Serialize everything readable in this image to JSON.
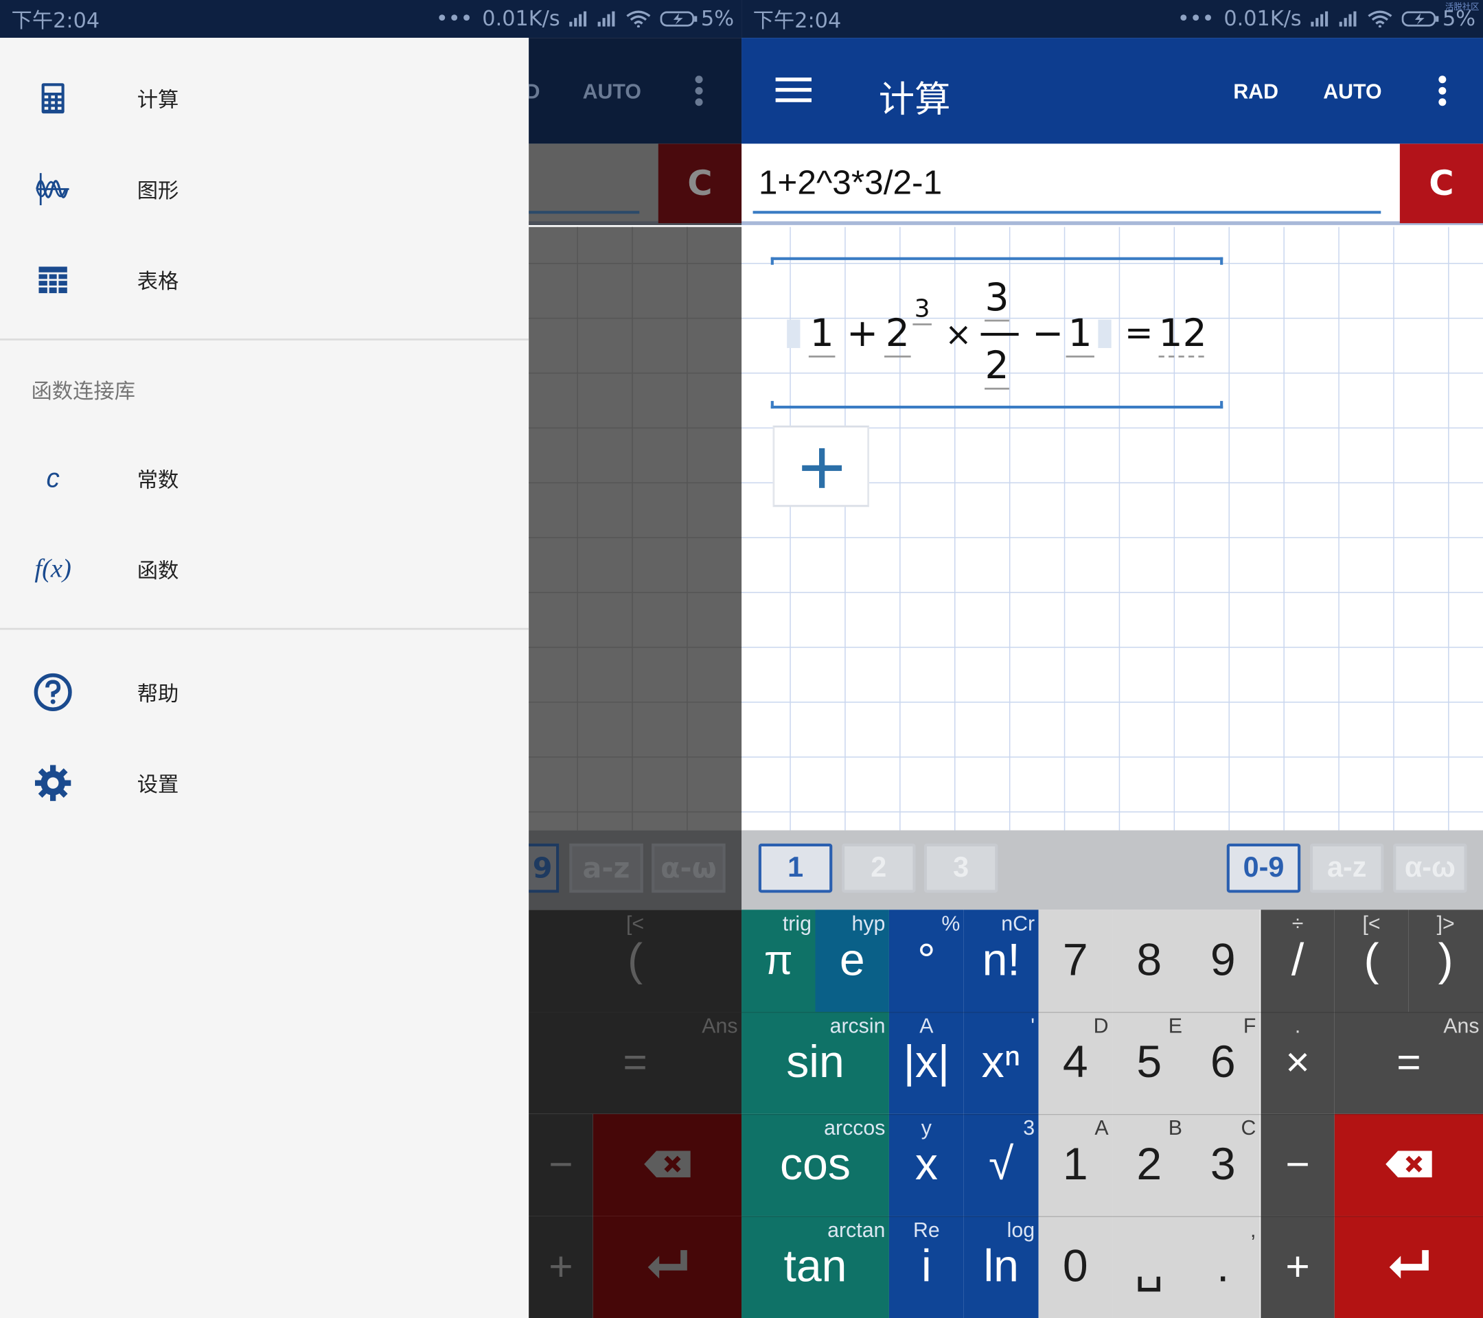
{
  "status": {
    "left_time": "下午2:04",
    "right_time": "下午2:04",
    "speed": "0.01K/s",
    "battery": "5%",
    "dots": "•••",
    "corner_tag": "活脱社区"
  },
  "appbar": {
    "menu_icon": "hamburger-icon",
    "title": "计算",
    "rad_label": "RAD",
    "auto_label": "AUTO",
    "overflow_icon": "more-vert-icon",
    "dim_partial_label": "D"
  },
  "input": {
    "expression": "1+2^3*3/2-1",
    "clear_label": "C"
  },
  "result": {
    "t1": "1",
    "op_plus": "+",
    "base": "2",
    "exp": "3",
    "op_times": "×",
    "num": "3",
    "den": "2",
    "op_minus": "−",
    "t2": "1",
    "eq": "=",
    "value": "12",
    "add_icon": "plus-icon"
  },
  "keyboard": {
    "tabs_left": [
      "1",
      "2",
      "3"
    ],
    "tabs_right": [
      "0-9",
      "a-z",
      "α-ω"
    ],
    "rows": [
      {
        "fn": [
          {
            "main": "π",
            "sup": "trig"
          },
          {
            "main": "e",
            "sup": "hyp"
          },
          {
            "main": "°",
            "sup": "%"
          },
          {
            "main": "n!",
            "sup": "nCr"
          }
        ],
        "num": [
          {
            "main": "7",
            "sup": ""
          },
          {
            "main": "8",
            "sup": ""
          },
          {
            "main": "9",
            "sup": ""
          }
        ],
        "ops": [
          {
            "main": "/",
            "sup": "÷"
          },
          {
            "main": "(",
            "sup": "[<"
          },
          {
            "main": ")",
            "sup": "]>"
          }
        ]
      },
      {
        "fn": [
          {
            "main": "sin",
            "sup": "arcsin"
          },
          {
            "main": "|x|",
            "sup": "A"
          },
          {
            "main": "xⁿ",
            "sup": "'"
          }
        ],
        "num": [
          {
            "main": "4",
            "sup": "D"
          },
          {
            "main": "5",
            "sup": "E"
          },
          {
            "main": "6",
            "sup": "F"
          }
        ],
        "ops": [
          {
            "main": "×",
            "sup": "."
          },
          {
            "main": "=",
            "sup": "Ans"
          }
        ]
      },
      {
        "fn": [
          {
            "main": "cos",
            "sup": "arccos"
          },
          {
            "main": "x",
            "sup": "y"
          },
          {
            "main": "√",
            "sup": "3"
          }
        ],
        "num": [
          {
            "main": "1",
            "sup": "A"
          },
          {
            "main": "2",
            "sup": "B"
          },
          {
            "main": "3",
            "sup": "C"
          }
        ],
        "ops": [
          {
            "main": "−",
            "sup": ""
          },
          {
            "main": "backspace-icon",
            "sup": ""
          }
        ]
      },
      {
        "fn": [
          {
            "main": "tan",
            "sup": "arctan"
          },
          {
            "main": "i",
            "sup": "Re"
          },
          {
            "main": "ln",
            "sup": "log"
          }
        ],
        "num": [
          {
            "main": "0",
            "sup": ""
          },
          {
            "main": "␣",
            "sup": ""
          },
          {
            "main": ".",
            "sup": ","
          }
        ],
        "ops": [
          {
            "main": "+",
            "sup": ""
          },
          {
            "main": "enter-icon",
            "sup": ""
          }
        ]
      }
    ]
  },
  "drawer": {
    "items": [
      {
        "icon": "calculator-icon",
        "label": "计算"
      },
      {
        "icon": "graph-icon",
        "label": "图形"
      },
      {
        "icon": "table-icon",
        "label": "表格"
      }
    ],
    "section_header": "函数连接库",
    "library_items": [
      {
        "icon": "constant-icon",
        "icon_text": "c",
        "label": "常数"
      },
      {
        "icon": "function-icon",
        "icon_text": "f(x)",
        "label": "函数"
      }
    ],
    "bottom_items": [
      {
        "icon": "help-icon",
        "label": "帮助"
      },
      {
        "icon": "settings-icon",
        "label": "设置"
      }
    ]
  },
  "colors": {
    "status_dark": "#0d2041",
    "appbar_blue": "#0d3d8f",
    "clear_red": "#b3131a",
    "key_teal": "#0f7267",
    "key_teal_blue": "#0a6088",
    "key_blue": "#0f4597",
    "key_gray": "#d6d6d6",
    "key_dark": "#4a4a4a",
    "key_red": "#b31313"
  }
}
